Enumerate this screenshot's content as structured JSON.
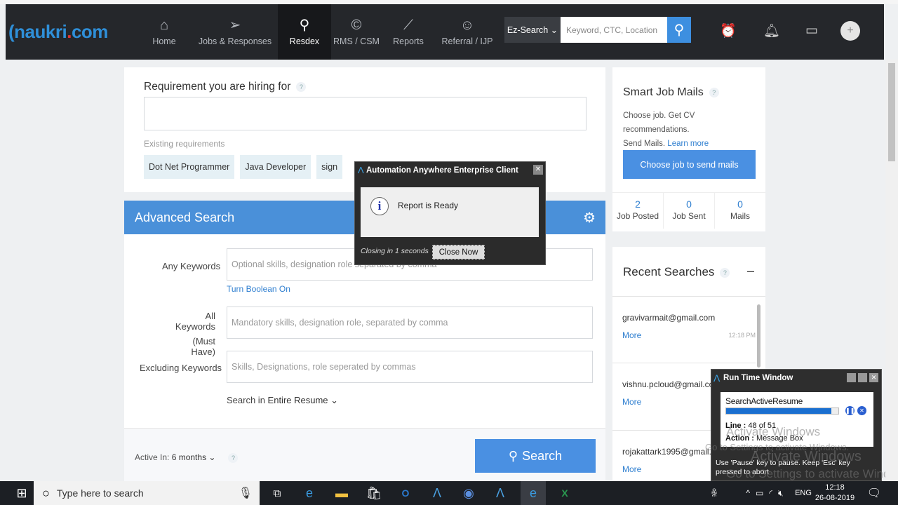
{
  "nav": {
    "logo_main": "naukri",
    "logo_dot": ".",
    "logo_tail": "com",
    "items": [
      {
        "label": "Home",
        "icon": "⌂"
      },
      {
        "label": "Jobs & Responses",
        "icon": "➢"
      },
      {
        "label": "Resdex",
        "icon": "⚲"
      },
      {
        "label": "RMS / CSM",
        "icon": "©"
      },
      {
        "label": "Reports",
        "icon": "⟋"
      },
      {
        "label": "Referral / IJP",
        "icon": "☺"
      }
    ],
    "ez_search": "Ez-Search ⌄",
    "search_placeholder": "Keyword, CTC, Location"
  },
  "requirement": {
    "title": "Requirement you are hiring for",
    "help": "?",
    "existing_label": "Existing requirements",
    "chips": [
      "Dot Net Programmer",
      "Java Developer",
      "sign"
    ]
  },
  "advanced": {
    "title": "Advanced Search",
    "any_label": "Any Keywords",
    "any_placeholder": "Optional skills, designation role separated by comma",
    "boolean_link": "Turn Boolean On",
    "all_label1": "All Keywords",
    "all_label2": "(Must Have)",
    "all_placeholder": "Mandatory skills, designation role, separated by comma",
    "excl_label": "Excluding Keywords",
    "excl_placeholder": "Skills, Designations, role seperated by commas",
    "search_in_label": "Search in",
    "search_in_value": "Entire Resume ⌄",
    "active_in_label": "Active In:",
    "active_in_value": "6 months ⌄",
    "help": "?",
    "search_button": "Search"
  },
  "smart": {
    "title": "Smart Job Mails",
    "help": "?",
    "desc1": "Choose job. Get CV recommendations.",
    "desc2": "Send Mails.",
    "learn_more": "Learn more",
    "button": "Choose job to send mails",
    "stats": [
      {
        "value": "2",
        "label": "Job Posted"
      },
      {
        "value": "0",
        "label": "Job Sent"
      },
      {
        "value": "0",
        "label": "Mails"
      }
    ]
  },
  "recent": {
    "title": "Recent Searches",
    "help": "?",
    "collapse": "–",
    "items": [
      {
        "email": "gravivarmait@gmail.com",
        "more": "More",
        "time": "12:18 PM"
      },
      {
        "email": "vishnu.pcloud@gmail.com",
        "more": "More"
      },
      {
        "email": "rojakattark1995@gmail.com",
        "more": "More"
      }
    ]
  },
  "dialog": {
    "title": "Automation Anywhere Enterprise Client",
    "message": "Report is Ready",
    "closing": "Closing in 1 seconds",
    "close_button": "Close Now"
  },
  "runtime": {
    "title": "Run Time Window",
    "task": "SearchActiveResume",
    "progress": 0.94,
    "line_label": "Line :",
    "line_value": "48 of 51",
    "action_label": "Action :",
    "action_value": "Message Box",
    "hint": "Use 'Pause' key to pause. Keep 'Esc' key pressed to abort"
  },
  "watermark": {
    "line1": "Activate Windows",
    "line2": "Go to Settings to activate Windows."
  },
  "taskbar": {
    "search_placeholder": "Type here to search",
    "lang": "ENG",
    "time": "12:18",
    "date": "26-08-2019"
  }
}
